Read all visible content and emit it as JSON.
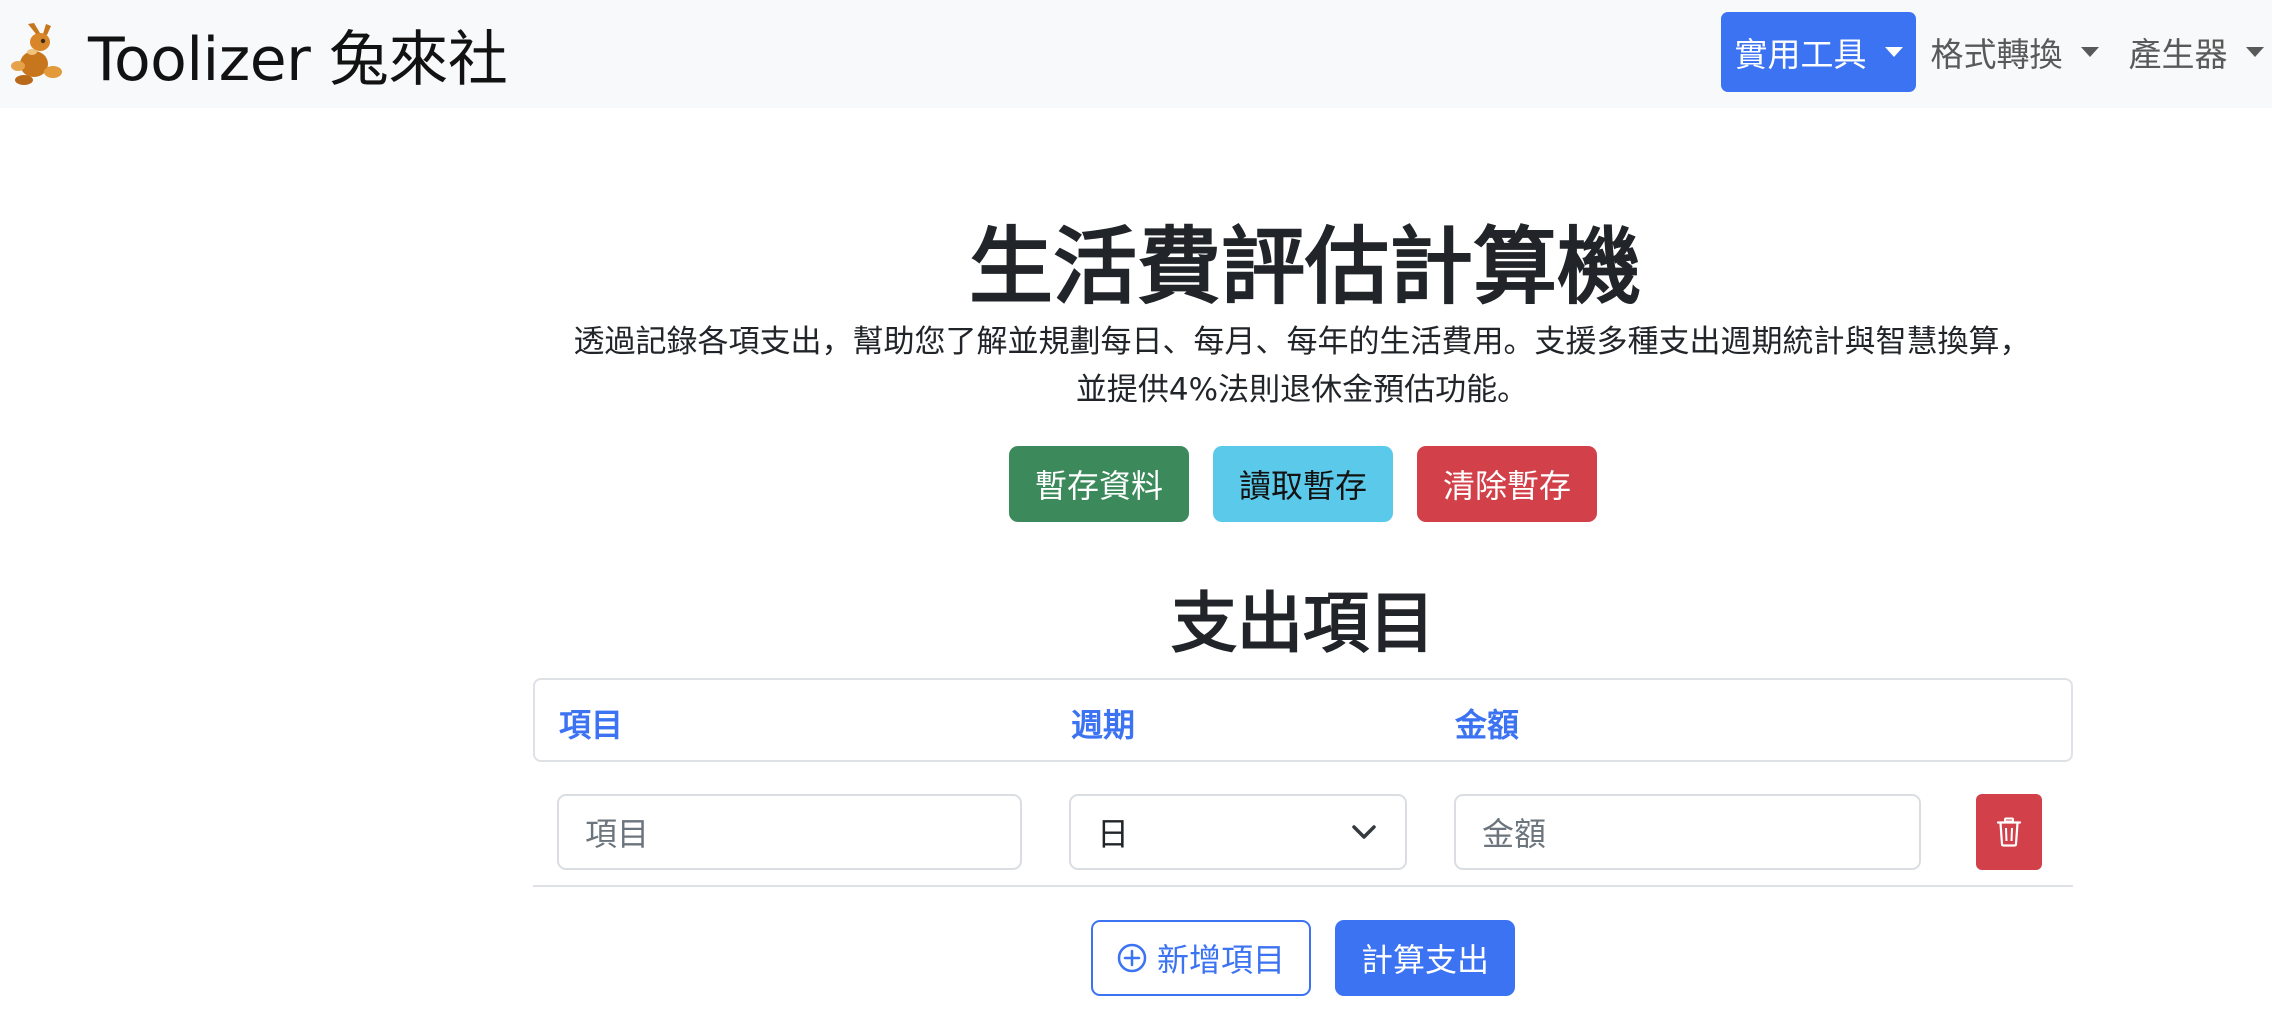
{
  "brand": {
    "name": "Toolizer 兔來社",
    "logo_icon": "rabbit-logo-icon"
  },
  "nav": {
    "items": [
      {
        "label": "實用工具",
        "active": true
      },
      {
        "label": "格式轉換",
        "active": false
      },
      {
        "label": "產生器",
        "active": false
      }
    ]
  },
  "page": {
    "title": "生活費評估計算機",
    "description": "透過記錄各項支出，幫助您了解並規劃每日、每月、每年的生活費用。支援多種支出週期統計與智慧換算，並提供4%法則退休金預估功能。"
  },
  "storage_buttons": {
    "save": "暫存資料",
    "load": "讀取暫存",
    "clear": "清除暫存"
  },
  "expenses": {
    "section_title": "支出項目",
    "columns": [
      "項目",
      "週期",
      "金額"
    ],
    "row": {
      "item_placeholder": "項目",
      "period_value": "日",
      "amount_placeholder": "金額"
    },
    "add_label": "新增項目",
    "calculate_label": "計算支出"
  },
  "colors": {
    "primary": "#3b73f2",
    "success": "#3c8a5c",
    "info": "#5ac9ea",
    "danger": "#d2404a",
    "navbar_bg": "#f8f9fa"
  }
}
